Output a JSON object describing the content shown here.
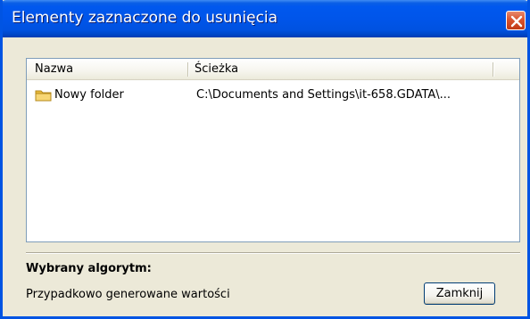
{
  "window": {
    "title": "Elementy zaznaczone do usunięcia",
    "close_icon": "close-icon"
  },
  "list": {
    "columns": [
      "Nazwa",
      "Ścieżka"
    ],
    "rows": [
      {
        "icon": "folder-icon",
        "name": "Nowy folder",
        "path": "C:\\Documents and Settings\\it-658.GDATA\\..."
      }
    ]
  },
  "algorithm": {
    "label": "Wybrany algorytm:",
    "value": "Przypadkowo generowane wartości"
  },
  "buttons": {
    "close_label": "Zamknij"
  },
  "colors": {
    "titlebar": "#0055ea",
    "window_bg": "#ece9d8",
    "close_button": "#d9542e",
    "folder": "#f2c94c"
  }
}
